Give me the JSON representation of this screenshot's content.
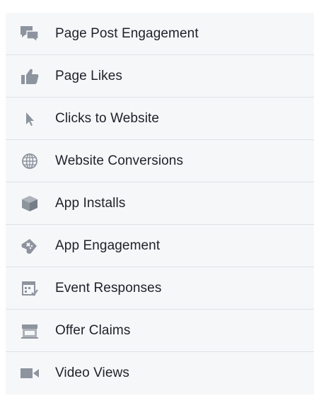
{
  "objectives": {
    "items": [
      {
        "label": "Page Post Engagement",
        "icon": "speech-bubbles-icon"
      },
      {
        "label": "Page Likes",
        "icon": "thumbs-up-icon"
      },
      {
        "label": "Clicks to Website",
        "icon": "cursor-arrow-icon"
      },
      {
        "label": "Website Conversions",
        "icon": "globe-icon"
      },
      {
        "label": "App Installs",
        "icon": "box-icon"
      },
      {
        "label": "App Engagement",
        "icon": "game-controller-icon"
      },
      {
        "label": "Event Responses",
        "icon": "calendar-icon"
      },
      {
        "label": "Offer Claims",
        "icon": "storefront-icon"
      },
      {
        "label": "Video Views",
        "icon": "video-camera-icon"
      }
    ]
  },
  "colors": {
    "icon": "#8d949e",
    "text": "#1d2129",
    "background": "#f6f7f9",
    "divider": "#e1e2e6"
  }
}
